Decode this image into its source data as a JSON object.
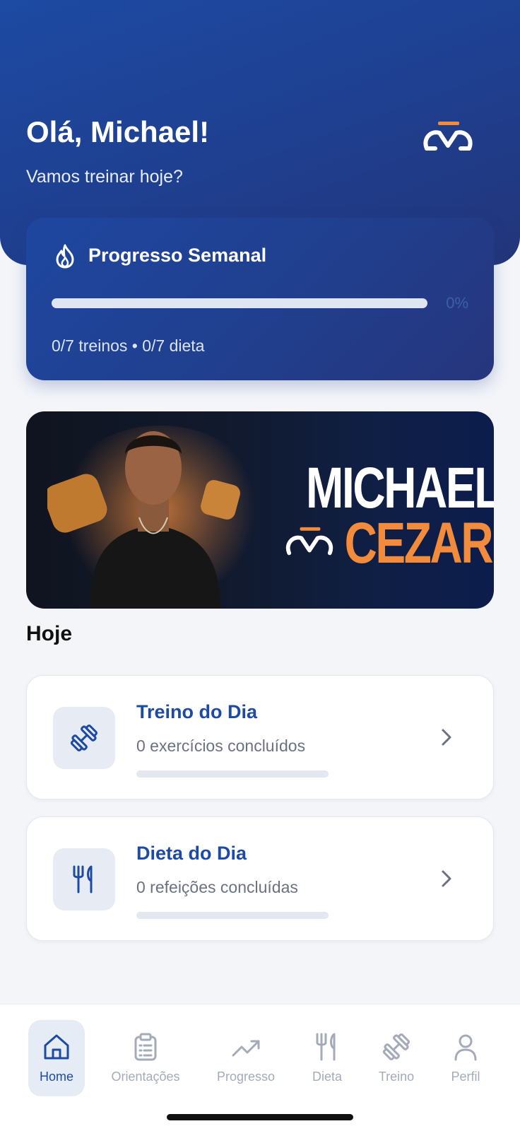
{
  "header": {
    "greeting": "Olá, Michael!",
    "subtitle": "Vamos treinar hoje?",
    "logo_icon": "brand-logo-icon"
  },
  "weekly_progress": {
    "title": "Progresso Semanal",
    "icon": "flame-icon",
    "percent_label": "0%",
    "progress": 0,
    "stats": "0/7 treinos • 0/7 dieta"
  },
  "banner": {
    "name_line1": "MICHAEL",
    "name_line2": "CEZAR"
  },
  "today": {
    "section_title": "Hoje",
    "cards": [
      {
        "title": "Treino do Dia",
        "subtitle": "0 exercícios concluídos",
        "icon": "dumbbell-icon",
        "progress": 0
      },
      {
        "title": "Dieta do Dia",
        "subtitle": "0 refeições concluídas",
        "icon": "fork-knife-icon",
        "progress": 0
      }
    ]
  },
  "nav": {
    "items": [
      {
        "label": "Home",
        "icon": "home-icon",
        "active": true
      },
      {
        "label": "Orientações",
        "icon": "clipboard-icon",
        "active": false
      },
      {
        "label": "Progresso",
        "icon": "trending-up-icon",
        "active": false
      },
      {
        "label": "Dieta",
        "icon": "fork-knife-icon",
        "active": false
      },
      {
        "label": "Treino",
        "icon": "dumbbell-icon",
        "active": false
      },
      {
        "label": "Perfil",
        "icon": "user-icon",
        "active": false
      }
    ]
  },
  "colors": {
    "primary": "#1d4aa3",
    "accent": "#f28c3c",
    "background": "#f3f5f9"
  }
}
